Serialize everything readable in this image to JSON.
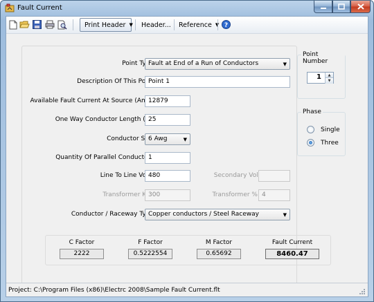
{
  "window": {
    "title": "Fault Current"
  },
  "toolbar": {
    "print_header": "Print Header",
    "header": "Header...",
    "reference": "Reference"
  },
  "form": {
    "point_type_label": "Point Type",
    "point_type_value": "Fault at End of a Run of Conductors",
    "description_label": "Description Of This Point",
    "description_value": "Point 1",
    "available_fault_label": "Available Fault Current At Source (Amp)",
    "available_fault_value": "12879",
    "conductor_length_label": "One Way Conductor Length (Ft)",
    "conductor_length_value": "25",
    "conductor_size_label": "Conductor Size",
    "conductor_size_value": "6 Awg",
    "parallel_label": "Quantity Of Parallel Conductors",
    "parallel_value": "1",
    "line_volts_label": "Line To Line Volts",
    "line_volts_value": "480",
    "secondary_volts_label": "Secondary Volts",
    "secondary_volts_value": "",
    "transformer_kva_label": "Transformer Kva",
    "transformer_kva_value": "300",
    "transformer_z_label": "Transformer % Z",
    "transformer_z_value": "4",
    "raceway_label": "Conductor / Raceway Type",
    "raceway_value": "Copper conductors / Steel Raceway"
  },
  "point_number": {
    "title": "Point Number",
    "value": "1"
  },
  "phase": {
    "title": "Phase",
    "single": "Single",
    "three": "Three",
    "selected": "Three"
  },
  "factors": {
    "c_label": "C Factor",
    "c_value": "2222",
    "f_label": "F Factor",
    "f_value": "0.5222554",
    "m_label": "M Factor",
    "m_value": "0.65692",
    "fault_label": "Fault Current",
    "fault_value": "8460.47"
  },
  "status": {
    "project": "Project: C:\\Program Files (x86)\\Electrc 2008\\Sample Fault Current.flt"
  }
}
